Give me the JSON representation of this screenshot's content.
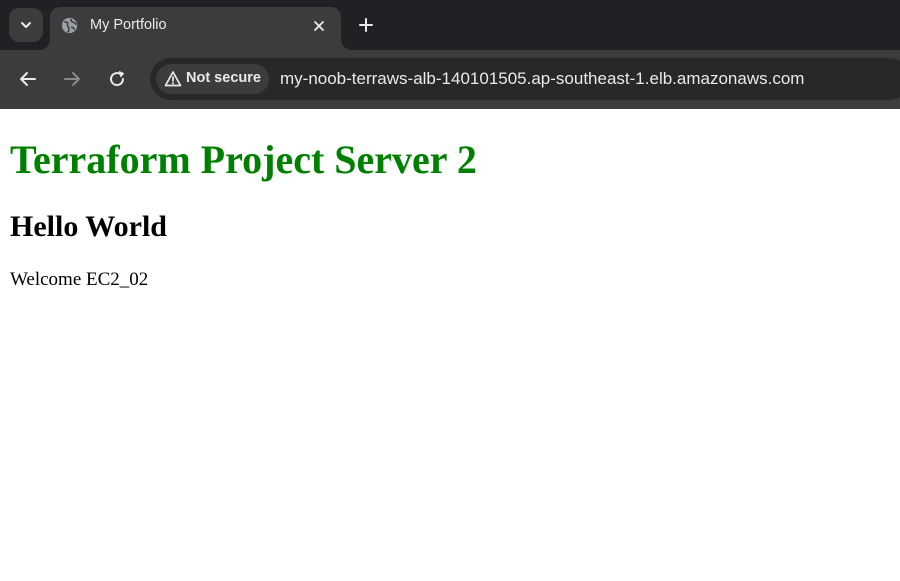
{
  "browser": {
    "tab": {
      "title": "My Portfolio",
      "favicon_icon": "globe-icon",
      "close_icon": "close-icon"
    },
    "tab_search_icon": "chevron-down-icon",
    "new_tab_icon": "plus-icon",
    "toolbar": {
      "back_icon": "arrow-left-icon",
      "forward_icon": "arrow-right-icon",
      "reload_icon": "reload-icon"
    },
    "omnibox": {
      "security_icon": "warning-triangle-icon",
      "security_label": "Not secure",
      "url": "my-noob-terraws-alb-140101505.ap-southeast-1.elb.amazonaws.com"
    },
    "colors": {
      "tabstrip_bg": "#202124",
      "toolbar_bg": "#3c3c3c",
      "omnibox_bg": "#282828",
      "text": "#e8eaed"
    }
  },
  "page": {
    "title": "Terraform Project Server 2",
    "title_color": "#008000",
    "heading": "Hello World",
    "body_text": "Welcome EC2_02"
  }
}
